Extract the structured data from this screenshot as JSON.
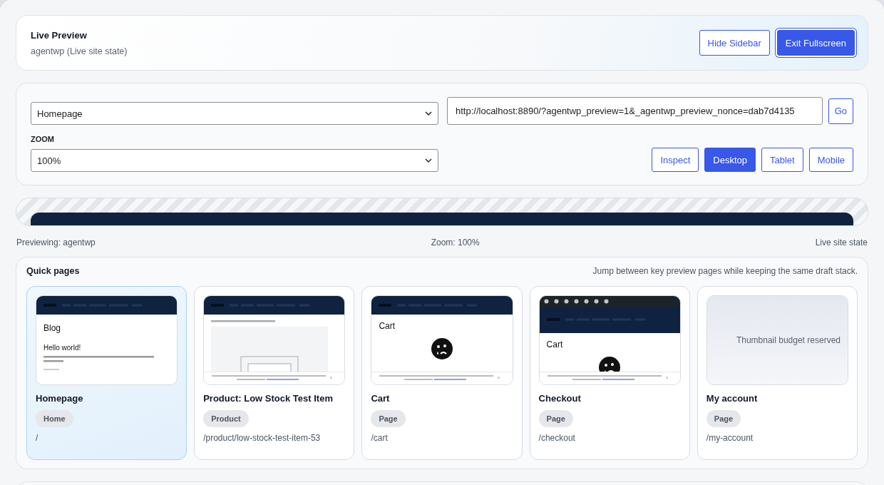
{
  "header": {
    "title": "Live Preview",
    "subtitle": "agentwp (Live site state)",
    "buttons": [
      {
        "label": "Hide Sidebar",
        "primary": false
      },
      {
        "label": "Exit Fullscreen",
        "primary": true
      }
    ]
  },
  "controls": {
    "page_select": {
      "value": "Homepage"
    },
    "url": {
      "value": "http://localhost:8890/?agentwp_preview=1&_agentwp_preview_nonce=dab7d4135"
    },
    "go_button": "Go",
    "zoom_label": "ZOOM",
    "zoom_select": {
      "value": "100%"
    },
    "modes": [
      {
        "label": "Inspect",
        "selected": false
      },
      {
        "label": "Desktop",
        "selected": true
      },
      {
        "label": "Tablet",
        "selected": false
      },
      {
        "label": "Mobile",
        "selected": false
      }
    ]
  },
  "status_bar": {
    "left": "Previewing: agentwp",
    "center": "Zoom: 100%",
    "right": "Live site state"
  },
  "quick_pages": {
    "title": "Quick pages",
    "hint": "Jump between key preview pages while keeping the same draft stack.",
    "pages": [
      {
        "title": "Homepage",
        "badge": "Home",
        "path": "/",
        "selected": true,
        "thumbnail": {
          "kind": "blog",
          "heading": "Blog",
          "post_title": "Hello world!"
        }
      },
      {
        "title": "Product: Low Stock Test Item",
        "badge": "Product",
        "path": "/product/low-stock-test-item-53",
        "selected": false,
        "thumbnail": {
          "kind": "product"
        }
      },
      {
        "title": "Cart",
        "badge": "Page",
        "path": "/cart",
        "selected": false,
        "thumbnail": {
          "kind": "cart",
          "admin_bar": false,
          "heading": "Cart"
        }
      },
      {
        "title": "Checkout",
        "badge": "Page",
        "path": "/checkout",
        "selected": false,
        "thumbnail": {
          "kind": "cart",
          "admin_bar": true,
          "heading": "Cart"
        }
      },
      {
        "title": "My account",
        "badge": "Page",
        "path": "/my-account",
        "selected": false,
        "thumbnail": {
          "kind": "placeholder",
          "text": "Thumbnail budget reserved"
        }
      }
    ]
  }
}
